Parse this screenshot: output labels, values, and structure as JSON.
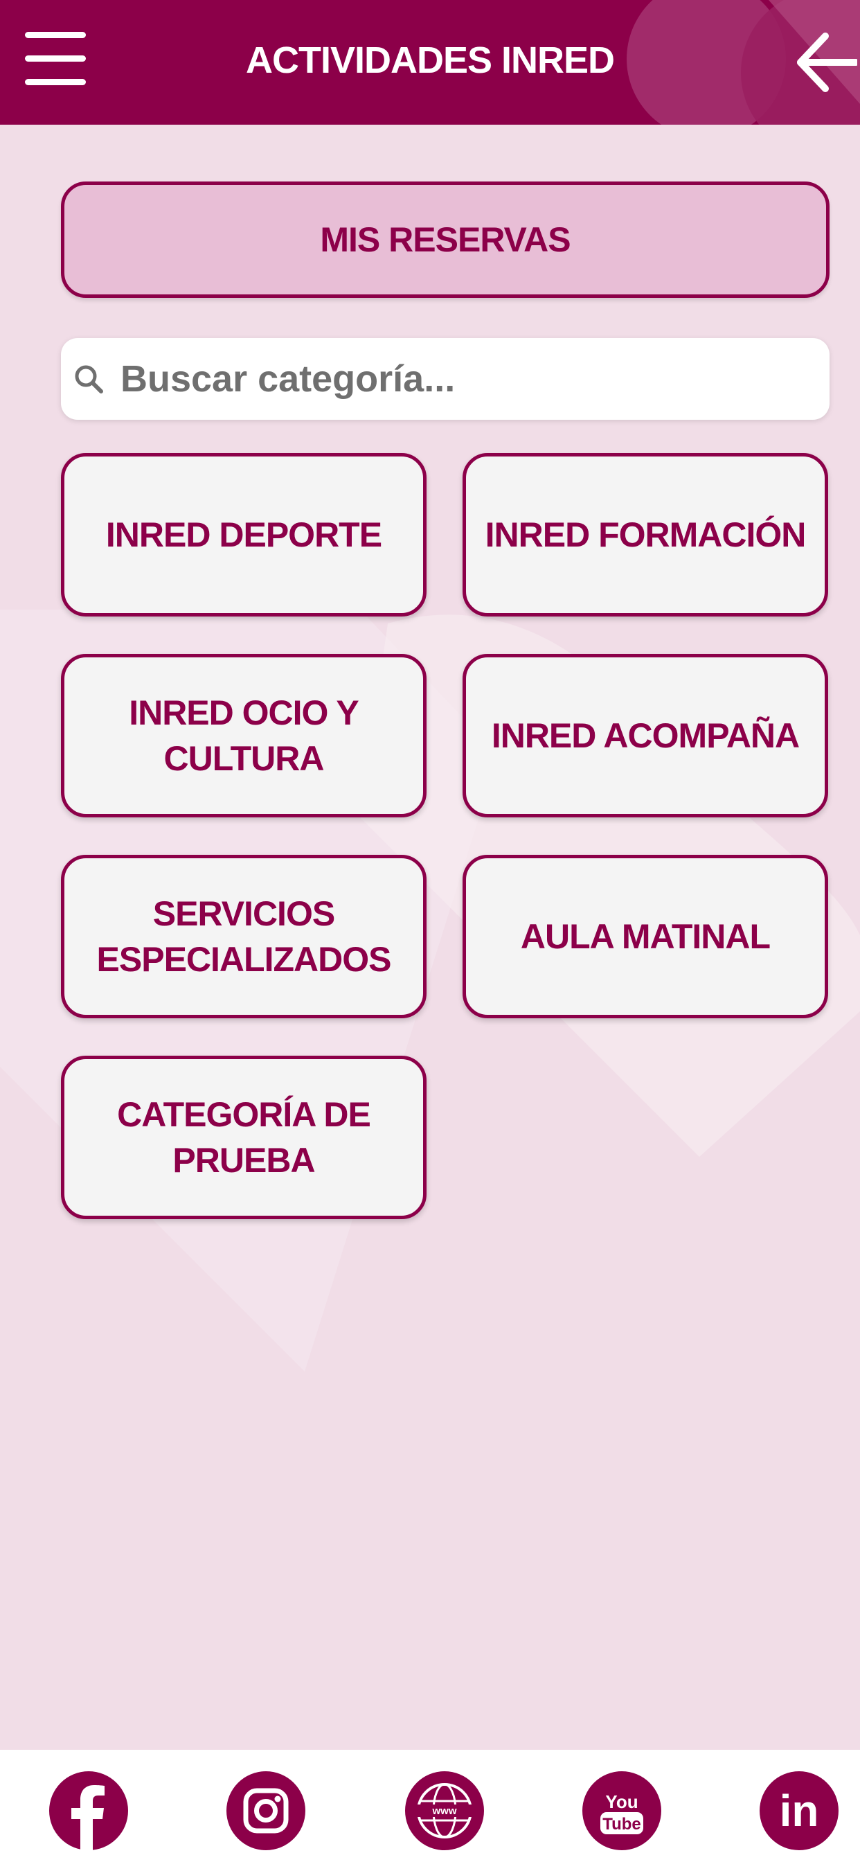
{
  "header": {
    "title": "ACTIVIDADES INRED"
  },
  "reservas": {
    "label": "MIS RESERVAS"
  },
  "search": {
    "placeholder": "Buscar categoría..."
  },
  "categories": [
    {
      "label": "INRED DEPORTE"
    },
    {
      "label": "INRED FORMACIÓN"
    },
    {
      "label": "INRED OCIO Y CULTURA"
    },
    {
      "label": "INRED ACOMPAÑA"
    },
    {
      "label": "SERVICIOS ESPECIALIZADOS"
    },
    {
      "label": "AULA MATINAL"
    },
    {
      "label": "CATEGORÍA DE PRUEBA"
    }
  ],
  "footer": {
    "icons": [
      "facebook-icon",
      "instagram-icon",
      "www-icon",
      "youtube-icon",
      "linkedin-icon"
    ],
    "youtube_text": {
      "top": "You",
      "bottom": "Tube"
    },
    "www_text": "www",
    "linkedin_text": "in"
  },
  "colors": {
    "brand": "#8c0049",
    "background": "#f1dde7",
    "button_fill": "#f4f4f4",
    "reservas_fill": "#e8bed6"
  }
}
